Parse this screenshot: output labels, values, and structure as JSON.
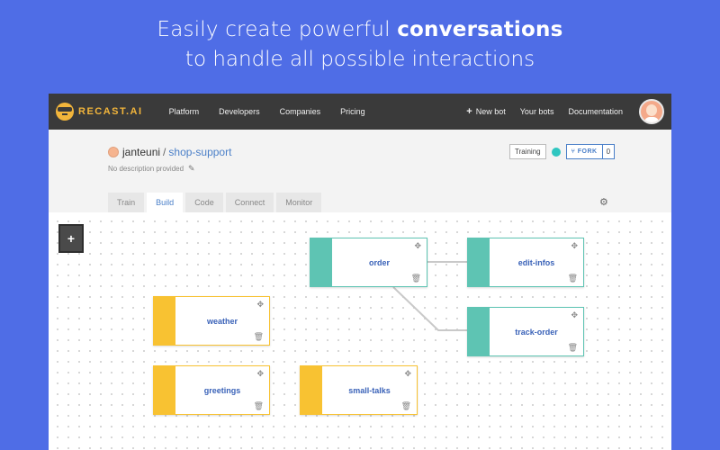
{
  "hero": {
    "line1_prefix": "Easily create powerful ",
    "line1_bold": "conversations",
    "line2": "to handle all possible interactions"
  },
  "nav": {
    "logo_text": "RECAST.AI",
    "links": [
      "Platform",
      "Developers",
      "Companies",
      "Pricing"
    ],
    "new_bot": "New bot",
    "your_bots": "Your bots",
    "documentation": "Documentation"
  },
  "repo": {
    "owner": "janteuni",
    "separator": "/",
    "name": "shop-support",
    "description": "No description provided"
  },
  "status": {
    "training": "Training",
    "status_color": "#2fc6c0",
    "fork_label": "FORK",
    "fork_count": "0"
  },
  "tabs": [
    "Train",
    "Build",
    "Code",
    "Connect",
    "Monitor"
  ],
  "active_tab": "Build",
  "canvas": {
    "add_button": "+",
    "nodes": [
      {
        "label": "order",
        "color": "teal"
      },
      {
        "label": "edit-infos",
        "color": "teal"
      },
      {
        "label": "track-order",
        "color": "teal"
      },
      {
        "label": "weather",
        "color": "yellow"
      },
      {
        "label": "greetings",
        "color": "yellow"
      },
      {
        "label": "small-talks",
        "color": "yellow"
      }
    ],
    "connections": [
      [
        "order",
        "edit-infos"
      ],
      [
        "order",
        "track-order"
      ]
    ]
  },
  "colors": {
    "background": "#4f6de6",
    "nav": "#3a3a3a",
    "accent": "#4a7fc8",
    "teal": "#5ec4b3",
    "yellow": "#f8c232",
    "logo": "#f2b53b"
  },
  "icons": {
    "move": "move-icon",
    "trash": "trash-icon",
    "gear": "gear-icon",
    "pencil": "pencil-icon",
    "plus": "plus-icon"
  }
}
